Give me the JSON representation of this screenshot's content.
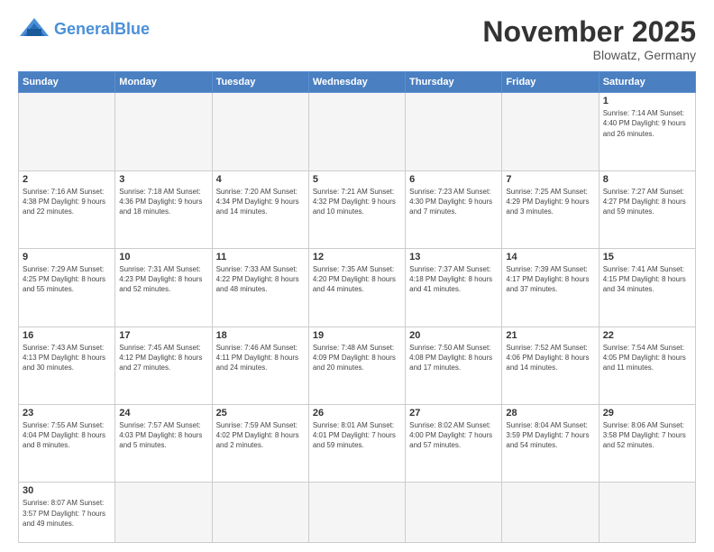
{
  "header": {
    "logo_general": "General",
    "logo_blue": "Blue",
    "month_title": "November 2025",
    "location": "Blowatz, Germany"
  },
  "days_of_week": [
    "Sunday",
    "Monday",
    "Tuesday",
    "Wednesday",
    "Thursday",
    "Friday",
    "Saturday"
  ],
  "weeks": [
    [
      {
        "day": "",
        "info": ""
      },
      {
        "day": "",
        "info": ""
      },
      {
        "day": "",
        "info": ""
      },
      {
        "day": "",
        "info": ""
      },
      {
        "day": "",
        "info": ""
      },
      {
        "day": "",
        "info": ""
      },
      {
        "day": "1",
        "info": "Sunrise: 7:14 AM\nSunset: 4:40 PM\nDaylight: 9 hours\nand 26 minutes."
      }
    ],
    [
      {
        "day": "2",
        "info": "Sunrise: 7:16 AM\nSunset: 4:38 PM\nDaylight: 9 hours\nand 22 minutes."
      },
      {
        "day": "3",
        "info": "Sunrise: 7:18 AM\nSunset: 4:36 PM\nDaylight: 9 hours\nand 18 minutes."
      },
      {
        "day": "4",
        "info": "Sunrise: 7:20 AM\nSunset: 4:34 PM\nDaylight: 9 hours\nand 14 minutes."
      },
      {
        "day": "5",
        "info": "Sunrise: 7:21 AM\nSunset: 4:32 PM\nDaylight: 9 hours\nand 10 minutes."
      },
      {
        "day": "6",
        "info": "Sunrise: 7:23 AM\nSunset: 4:30 PM\nDaylight: 9 hours\nand 7 minutes."
      },
      {
        "day": "7",
        "info": "Sunrise: 7:25 AM\nSunset: 4:29 PM\nDaylight: 9 hours\nand 3 minutes."
      },
      {
        "day": "8",
        "info": "Sunrise: 7:27 AM\nSunset: 4:27 PM\nDaylight: 8 hours\nand 59 minutes."
      }
    ],
    [
      {
        "day": "9",
        "info": "Sunrise: 7:29 AM\nSunset: 4:25 PM\nDaylight: 8 hours\nand 55 minutes."
      },
      {
        "day": "10",
        "info": "Sunrise: 7:31 AM\nSunset: 4:23 PM\nDaylight: 8 hours\nand 52 minutes."
      },
      {
        "day": "11",
        "info": "Sunrise: 7:33 AM\nSunset: 4:22 PM\nDaylight: 8 hours\nand 48 minutes."
      },
      {
        "day": "12",
        "info": "Sunrise: 7:35 AM\nSunset: 4:20 PM\nDaylight: 8 hours\nand 44 minutes."
      },
      {
        "day": "13",
        "info": "Sunrise: 7:37 AM\nSunset: 4:18 PM\nDaylight: 8 hours\nand 41 minutes."
      },
      {
        "day": "14",
        "info": "Sunrise: 7:39 AM\nSunset: 4:17 PM\nDaylight: 8 hours\nand 37 minutes."
      },
      {
        "day": "15",
        "info": "Sunrise: 7:41 AM\nSunset: 4:15 PM\nDaylight: 8 hours\nand 34 minutes."
      }
    ],
    [
      {
        "day": "16",
        "info": "Sunrise: 7:43 AM\nSunset: 4:13 PM\nDaylight: 8 hours\nand 30 minutes."
      },
      {
        "day": "17",
        "info": "Sunrise: 7:45 AM\nSunset: 4:12 PM\nDaylight: 8 hours\nand 27 minutes."
      },
      {
        "day": "18",
        "info": "Sunrise: 7:46 AM\nSunset: 4:11 PM\nDaylight: 8 hours\nand 24 minutes."
      },
      {
        "day": "19",
        "info": "Sunrise: 7:48 AM\nSunset: 4:09 PM\nDaylight: 8 hours\nand 20 minutes."
      },
      {
        "day": "20",
        "info": "Sunrise: 7:50 AM\nSunset: 4:08 PM\nDaylight: 8 hours\nand 17 minutes."
      },
      {
        "day": "21",
        "info": "Sunrise: 7:52 AM\nSunset: 4:06 PM\nDaylight: 8 hours\nand 14 minutes."
      },
      {
        "day": "22",
        "info": "Sunrise: 7:54 AM\nSunset: 4:05 PM\nDaylight: 8 hours\nand 11 minutes."
      }
    ],
    [
      {
        "day": "23",
        "info": "Sunrise: 7:55 AM\nSunset: 4:04 PM\nDaylight: 8 hours\nand 8 minutes."
      },
      {
        "day": "24",
        "info": "Sunrise: 7:57 AM\nSunset: 4:03 PM\nDaylight: 8 hours\nand 5 minutes."
      },
      {
        "day": "25",
        "info": "Sunrise: 7:59 AM\nSunset: 4:02 PM\nDaylight: 8 hours\nand 2 minutes."
      },
      {
        "day": "26",
        "info": "Sunrise: 8:01 AM\nSunset: 4:01 PM\nDaylight: 7 hours\nand 59 minutes."
      },
      {
        "day": "27",
        "info": "Sunrise: 8:02 AM\nSunset: 4:00 PM\nDaylight: 7 hours\nand 57 minutes."
      },
      {
        "day": "28",
        "info": "Sunrise: 8:04 AM\nSunset: 3:59 PM\nDaylight: 7 hours\nand 54 minutes."
      },
      {
        "day": "29",
        "info": "Sunrise: 8:06 AM\nSunset: 3:58 PM\nDaylight: 7 hours\nand 52 minutes."
      }
    ],
    [
      {
        "day": "30",
        "info": "Sunrise: 8:07 AM\nSunset: 3:57 PM\nDaylight: 7 hours\nand 49 minutes."
      },
      {
        "day": "",
        "info": ""
      },
      {
        "day": "",
        "info": ""
      },
      {
        "day": "",
        "info": ""
      },
      {
        "day": "",
        "info": ""
      },
      {
        "day": "",
        "info": ""
      },
      {
        "day": "",
        "info": ""
      }
    ]
  ]
}
